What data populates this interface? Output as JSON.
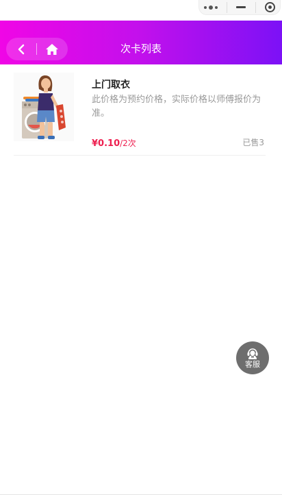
{
  "header": {
    "title": "次卡列表"
  },
  "capsule": {
    "menu_icon": "more-dots-icon",
    "minimize_icon": "minimize-icon",
    "close_icon": "target-close-icon"
  },
  "nav": {
    "back_icon": "chevron-left-icon",
    "home_icon": "home-icon"
  },
  "items": [
    {
      "name": "上门取衣",
      "description": "此价格为预约价格，实际价格以师傅报价为准。",
      "price": "¥0.10",
      "per": "/2次",
      "sold": "已售3",
      "image_icon": "laundry-woman-illustration"
    }
  ],
  "service": {
    "label": "客服",
    "icon": "headset-agent-icon"
  },
  "colors": {
    "gradient_start": "#f006e6",
    "gradient_end": "#7c11f6",
    "price": "#ee1f4f",
    "muted_text": "#999999",
    "service_bg": "#6e6e6e"
  }
}
